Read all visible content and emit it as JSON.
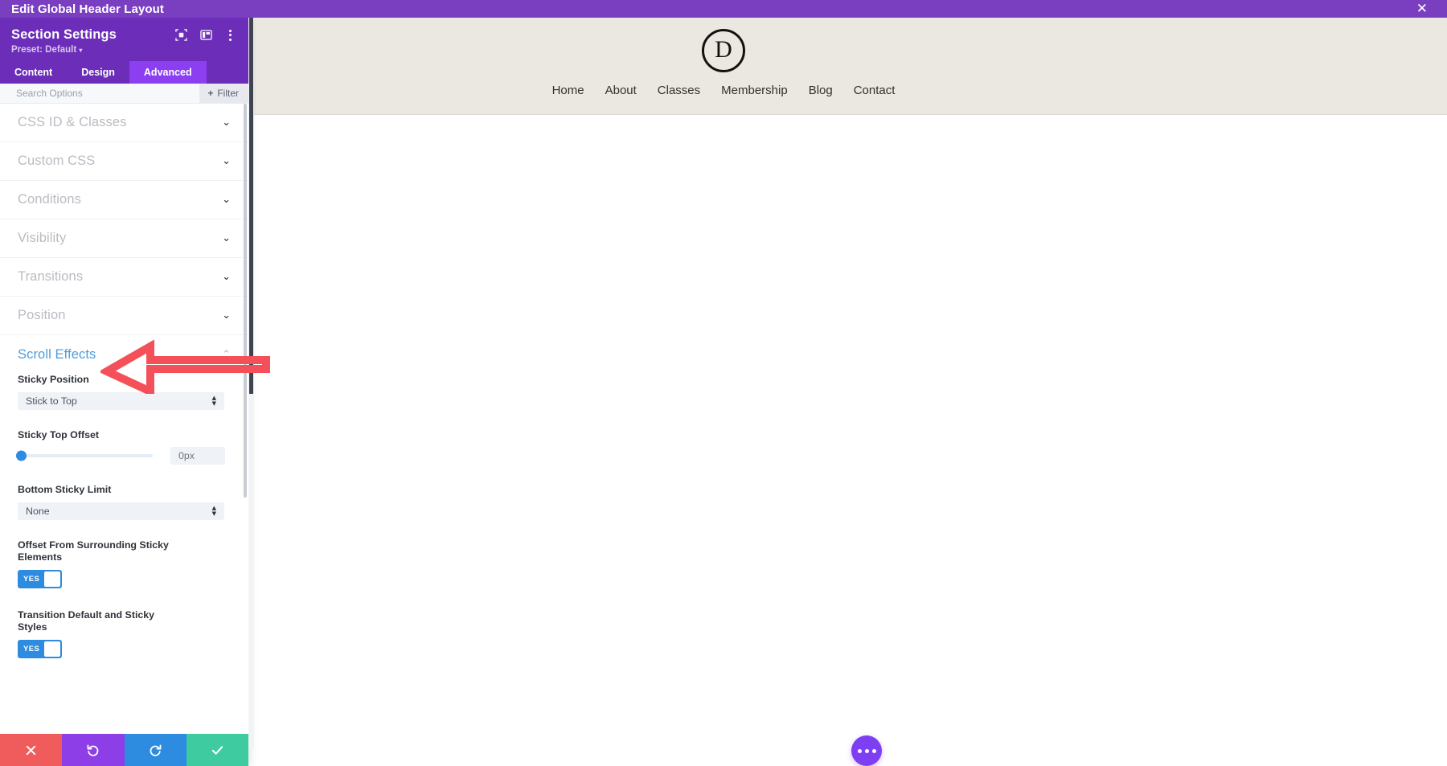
{
  "window": {
    "title": "Edit Global Header Layout",
    "close_icon": "close-icon",
    "titlebar_color": "#7a3ec1"
  },
  "panel": {
    "title": "Section Settings",
    "preset_label": "Preset: Default",
    "preset_caret": "▾",
    "header_icons": [
      {
        "name": "focus-target-icon",
        "glyph": "⊡"
      },
      {
        "name": "layout-columns-icon",
        "glyph": "▥"
      },
      {
        "name": "kebab-menu-icon",
        "glyph": "⋮"
      }
    ],
    "tabs": [
      {
        "label": "Content",
        "active": false
      },
      {
        "label": "Design",
        "active": false
      },
      {
        "label": "Advanced",
        "active": true
      }
    ],
    "search": {
      "placeholder": "Search Options",
      "value": ""
    },
    "filter_button": {
      "label": "Filter",
      "plus": "✛"
    },
    "accordions": [
      {
        "label": "CSS ID & Classes",
        "expanded": false
      },
      {
        "label": "Custom CSS",
        "expanded": false
      },
      {
        "label": "Conditions",
        "expanded": false
      },
      {
        "label": "Visibility",
        "expanded": false
      },
      {
        "label": "Transitions",
        "expanded": false
      },
      {
        "label": "Position",
        "expanded": false
      }
    ],
    "open_section": {
      "label": "Scroll Effects",
      "expanded": true,
      "accent_color": "#4f9cdb",
      "fields": {
        "sticky_position": {
          "label": "Sticky Position",
          "value": "Stick to Top"
        },
        "sticky_top_offset": {
          "label": "Sticky Top Offset",
          "value": "0px",
          "slider_percent": 0
        },
        "bottom_sticky_limit": {
          "label": "Bottom Sticky Limit",
          "value": "None"
        },
        "offset_from_surrounding": {
          "label": "Offset From Surrounding Sticky Elements",
          "toggle_value": "YES"
        },
        "transition_default_sticky": {
          "label": "Transition Default and Sticky Styles",
          "toggle_value": "YES"
        }
      }
    },
    "actions": [
      {
        "name": "cancel",
        "glyph": "✖",
        "color": "#f05b5b"
      },
      {
        "name": "undo",
        "glyph": "↺",
        "color": "#8e3ee6"
      },
      {
        "name": "redo",
        "glyph": "↻",
        "color": "#2d8ce0"
      },
      {
        "name": "save",
        "glyph": "✔",
        "color": "#3ecba0"
      }
    ]
  },
  "preview": {
    "logo_letter": "D",
    "nav": [
      {
        "label": "Home"
      },
      {
        "label": "About"
      },
      {
        "label": "Classes"
      },
      {
        "label": "Membership"
      },
      {
        "label": "Blog"
      },
      {
        "label": "Contact"
      }
    ],
    "header_bg": "#eae8e1",
    "fab": {
      "name": "more-options-fab",
      "color": "#7e3ff2"
    }
  },
  "annotation": {
    "type": "arrow",
    "color": "#f4505a",
    "points_to": "Scroll Effects"
  }
}
